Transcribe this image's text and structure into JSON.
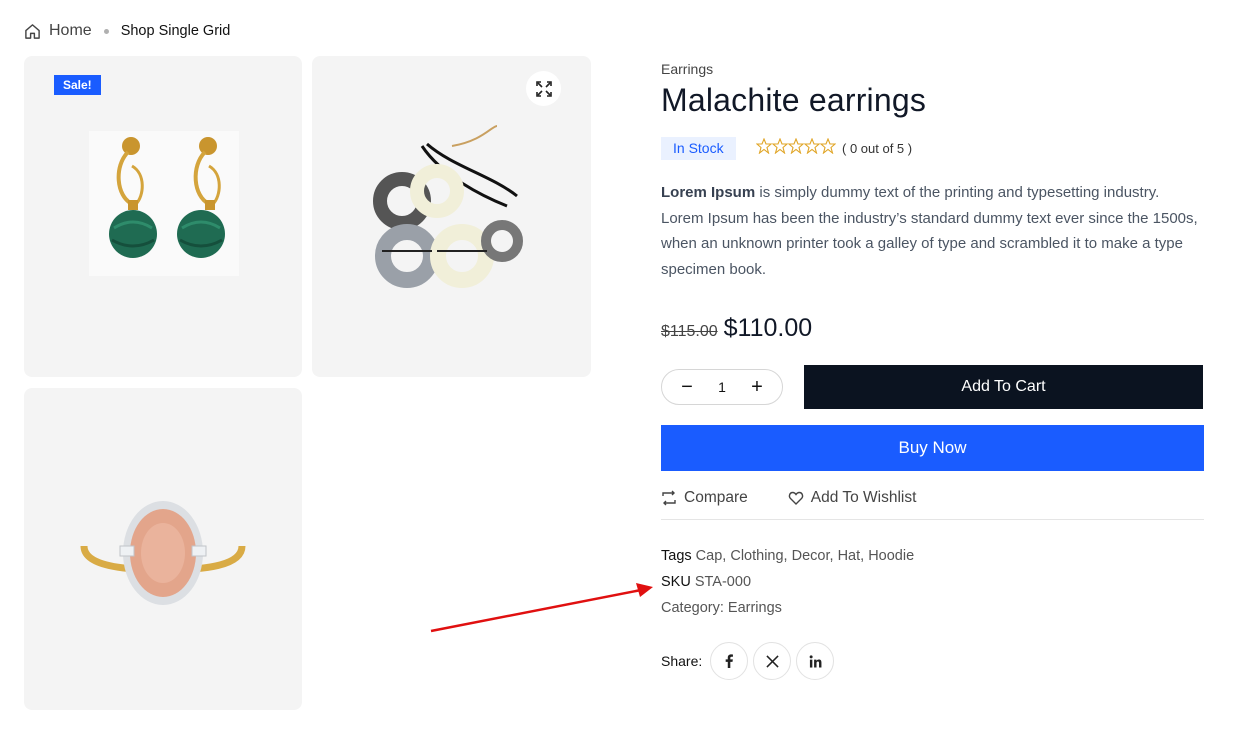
{
  "breadcrumb": {
    "home": "Home",
    "current": "Shop Single Grid"
  },
  "gallery": {
    "sale_badge": "Sale!"
  },
  "product": {
    "category": "Earrings",
    "title": "Malachite earrings",
    "stock": "In Stock",
    "rating": {
      "value": 0,
      "max": 5,
      "text": "( 0 out of 5 )"
    },
    "description_bold": "Lorem Ipsum",
    "description_rest": " is simply dummy text of the printing and typesetting industry. Lorem Ipsum has been the industry’s standard dummy text ever since the 1500s, when an unknown printer took a galley of type and scrambled it to make a type specimen book.",
    "old_price": "$115.00",
    "price": "$110.00",
    "quantity": "1"
  },
  "buttons": {
    "add_to_cart": "Add To Cart",
    "buy_now": "Buy Now",
    "compare": "Compare",
    "wishlist": "Add To Wishlist"
  },
  "meta": {
    "tags_label": "Tags",
    "tags": [
      "Cap",
      "Clothing",
      "Decor",
      "Hat",
      "Hoodie"
    ],
    "sku_label": "SKU",
    "sku": "STA-000",
    "category_label": "Category:",
    "category": "Earrings"
  },
  "share": {
    "label": "Share:",
    "networks": [
      "facebook-icon",
      "x-icon",
      "linkedin-icon"
    ]
  },
  "colors": {
    "accent": "#1a5cff",
    "dark": "#0b1320",
    "star": "#e0a526",
    "arrow": "#e01010"
  }
}
